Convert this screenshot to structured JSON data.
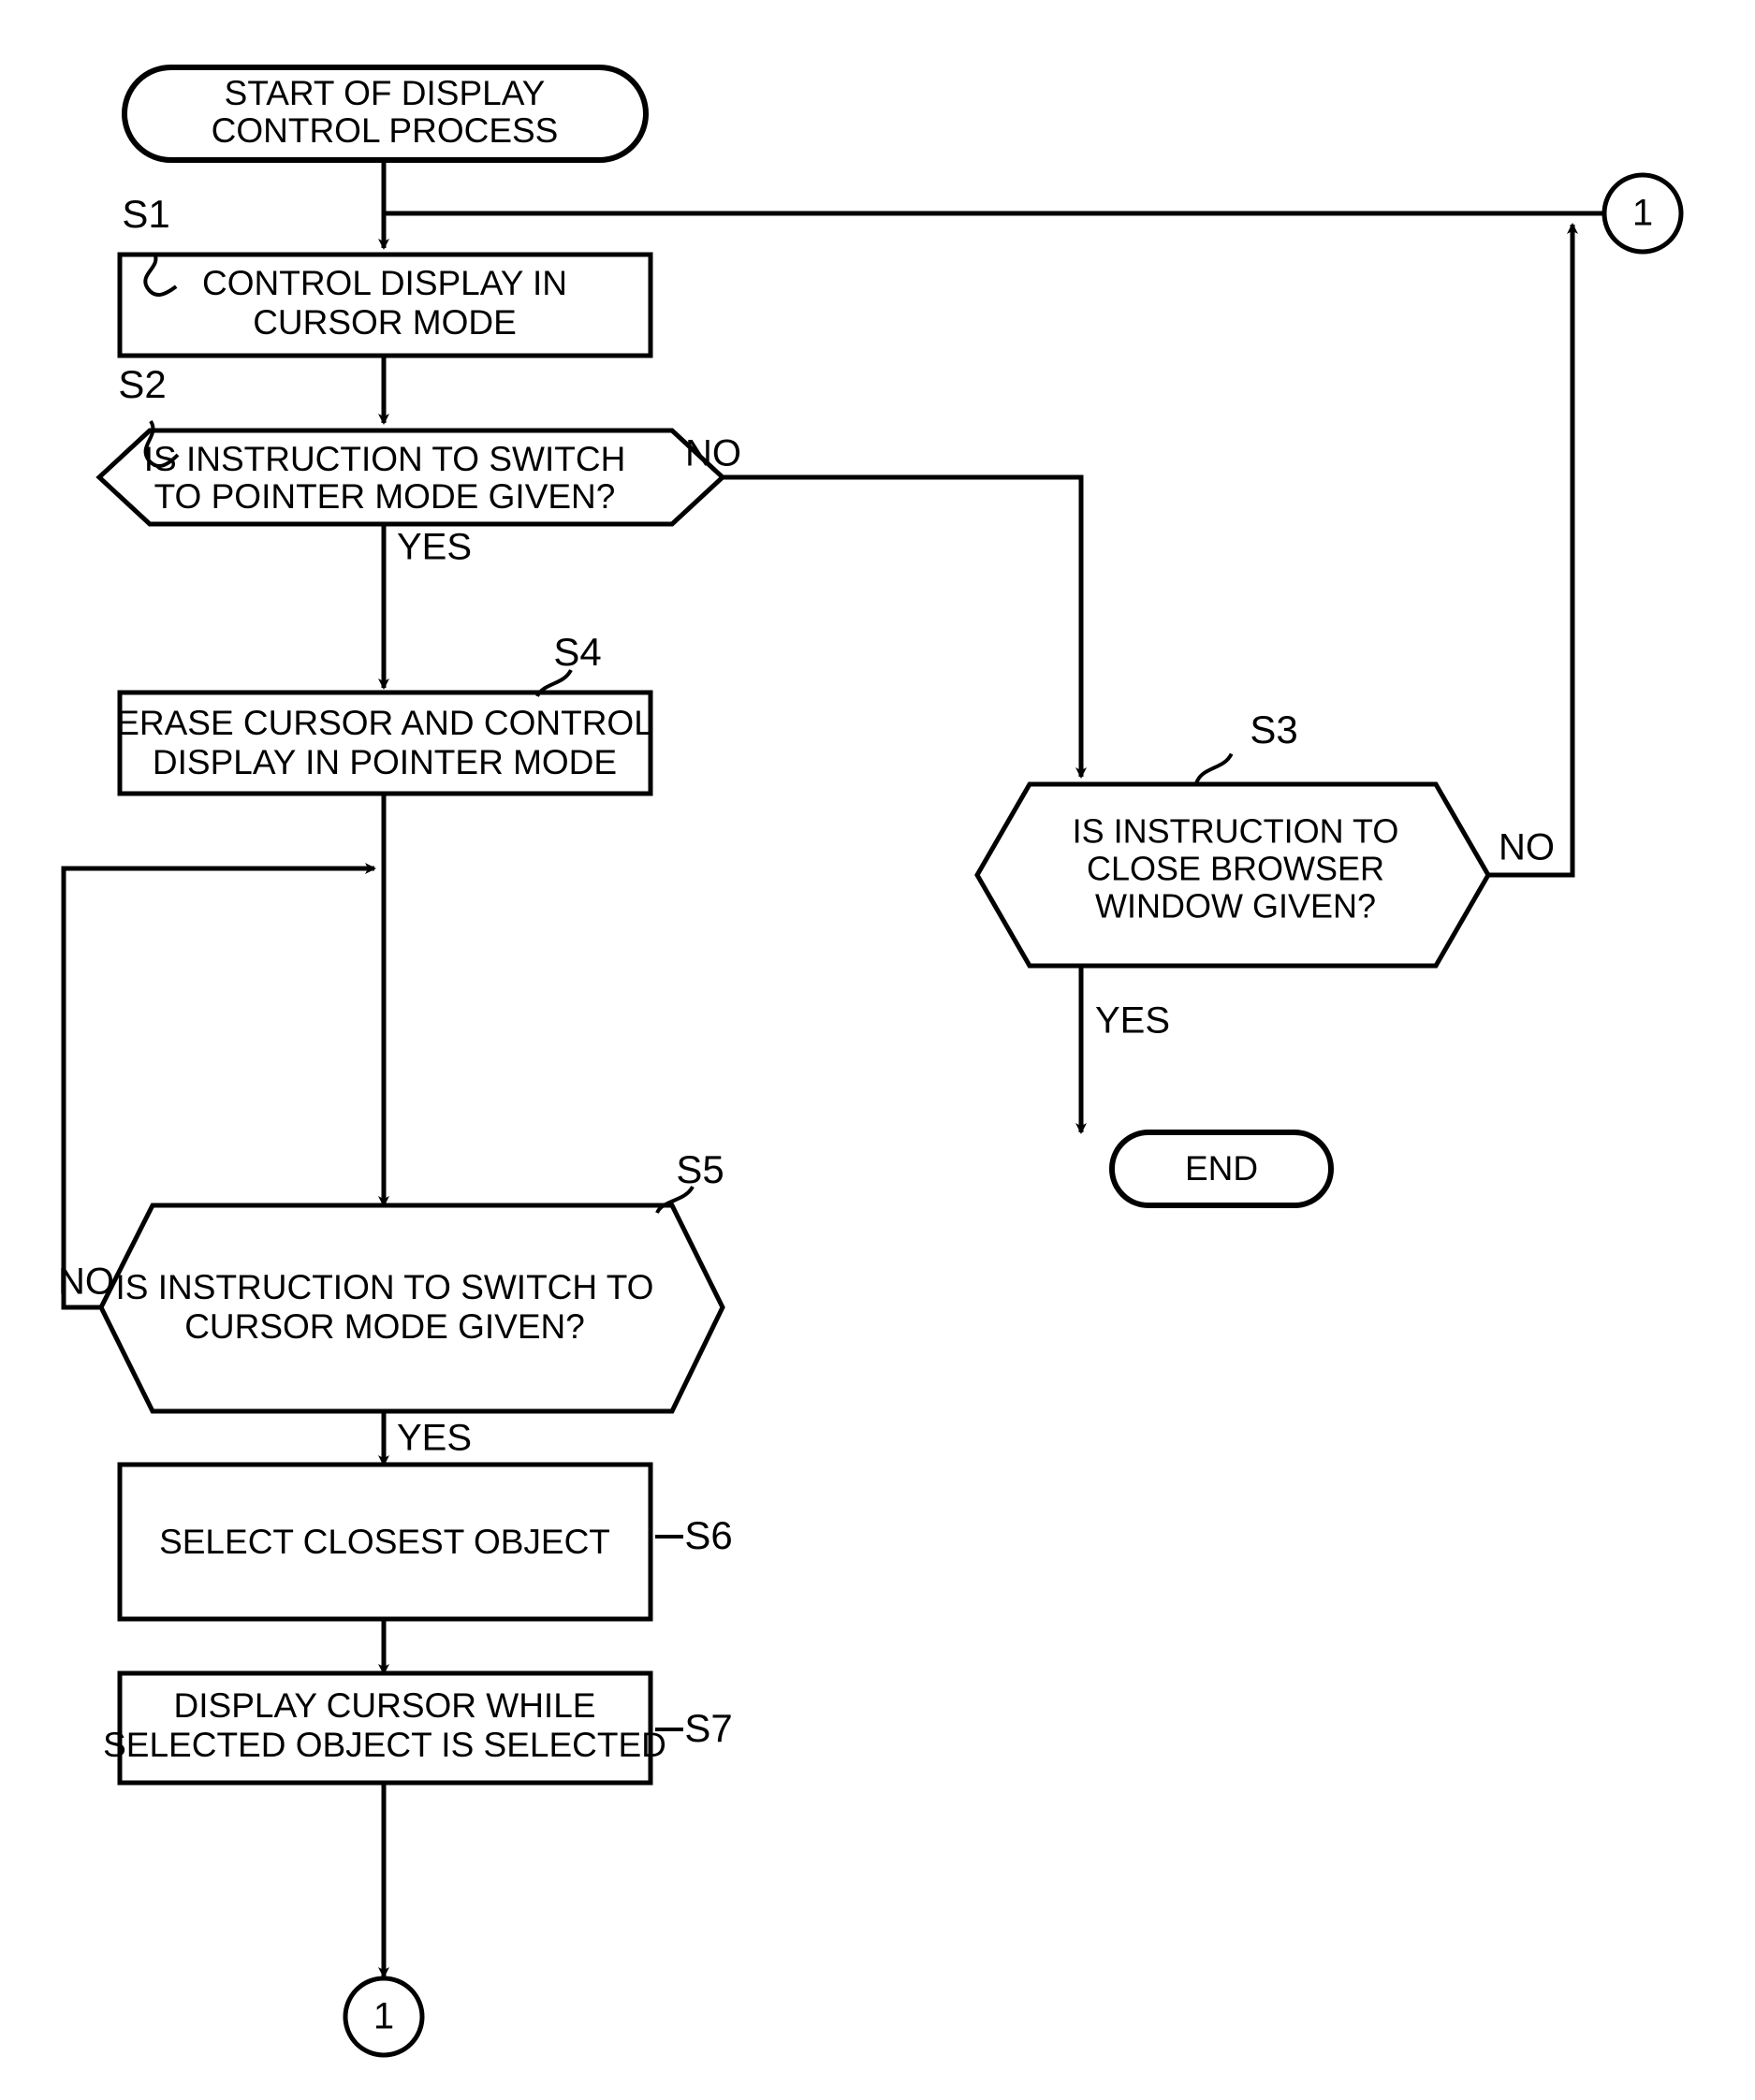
{
  "diagram": {
    "title": "Display Control Process Flowchart",
    "stroke_color": "#000000",
    "background_color": "#ffffff",
    "nodes": {
      "start": {
        "type": "terminator",
        "line1": "START OF DISPLAY",
        "line2": "CONTROL PROCESS"
      },
      "s1": {
        "type": "process",
        "step": "S1",
        "line1": "CONTROL DISPLAY IN",
        "line2": "CURSOR MODE"
      },
      "s2": {
        "type": "decision",
        "step": "S2",
        "line1": "IS INSTRUCTION TO SWITCH",
        "line2": "TO POINTER MODE GIVEN?",
        "yes_label": "YES",
        "no_label": "NO"
      },
      "s3": {
        "type": "decision",
        "step": "S3",
        "line1": "IS INSTRUCTION TO",
        "line2": "CLOSE BROWSER",
        "line3": "WINDOW GIVEN?",
        "yes_label": "YES",
        "no_label": "NO"
      },
      "s4": {
        "type": "process",
        "step": "S4",
        "line1": "ERASE CURSOR AND CONTROL",
        "line2": "DISPLAY IN POINTER MODE"
      },
      "s5": {
        "type": "decision",
        "step": "S5",
        "line1": "IS INSTRUCTION TO SWITCH TO",
        "line2": "CURSOR MODE GIVEN?",
        "yes_label": "YES",
        "no_label": "NO"
      },
      "s6": {
        "type": "process",
        "step": "S6",
        "line1": "SELECT CLOSEST OBJECT"
      },
      "s7": {
        "type": "process",
        "step": "S7",
        "line1": "DISPLAY CURSOR WHILE",
        "line2": "SELECTED OBJECT IS SELECTED"
      },
      "end": {
        "type": "terminator",
        "line1": "END"
      },
      "connector_top": {
        "type": "connector",
        "label": "1"
      },
      "connector_bottom": {
        "type": "connector",
        "label": "1"
      }
    }
  }
}
